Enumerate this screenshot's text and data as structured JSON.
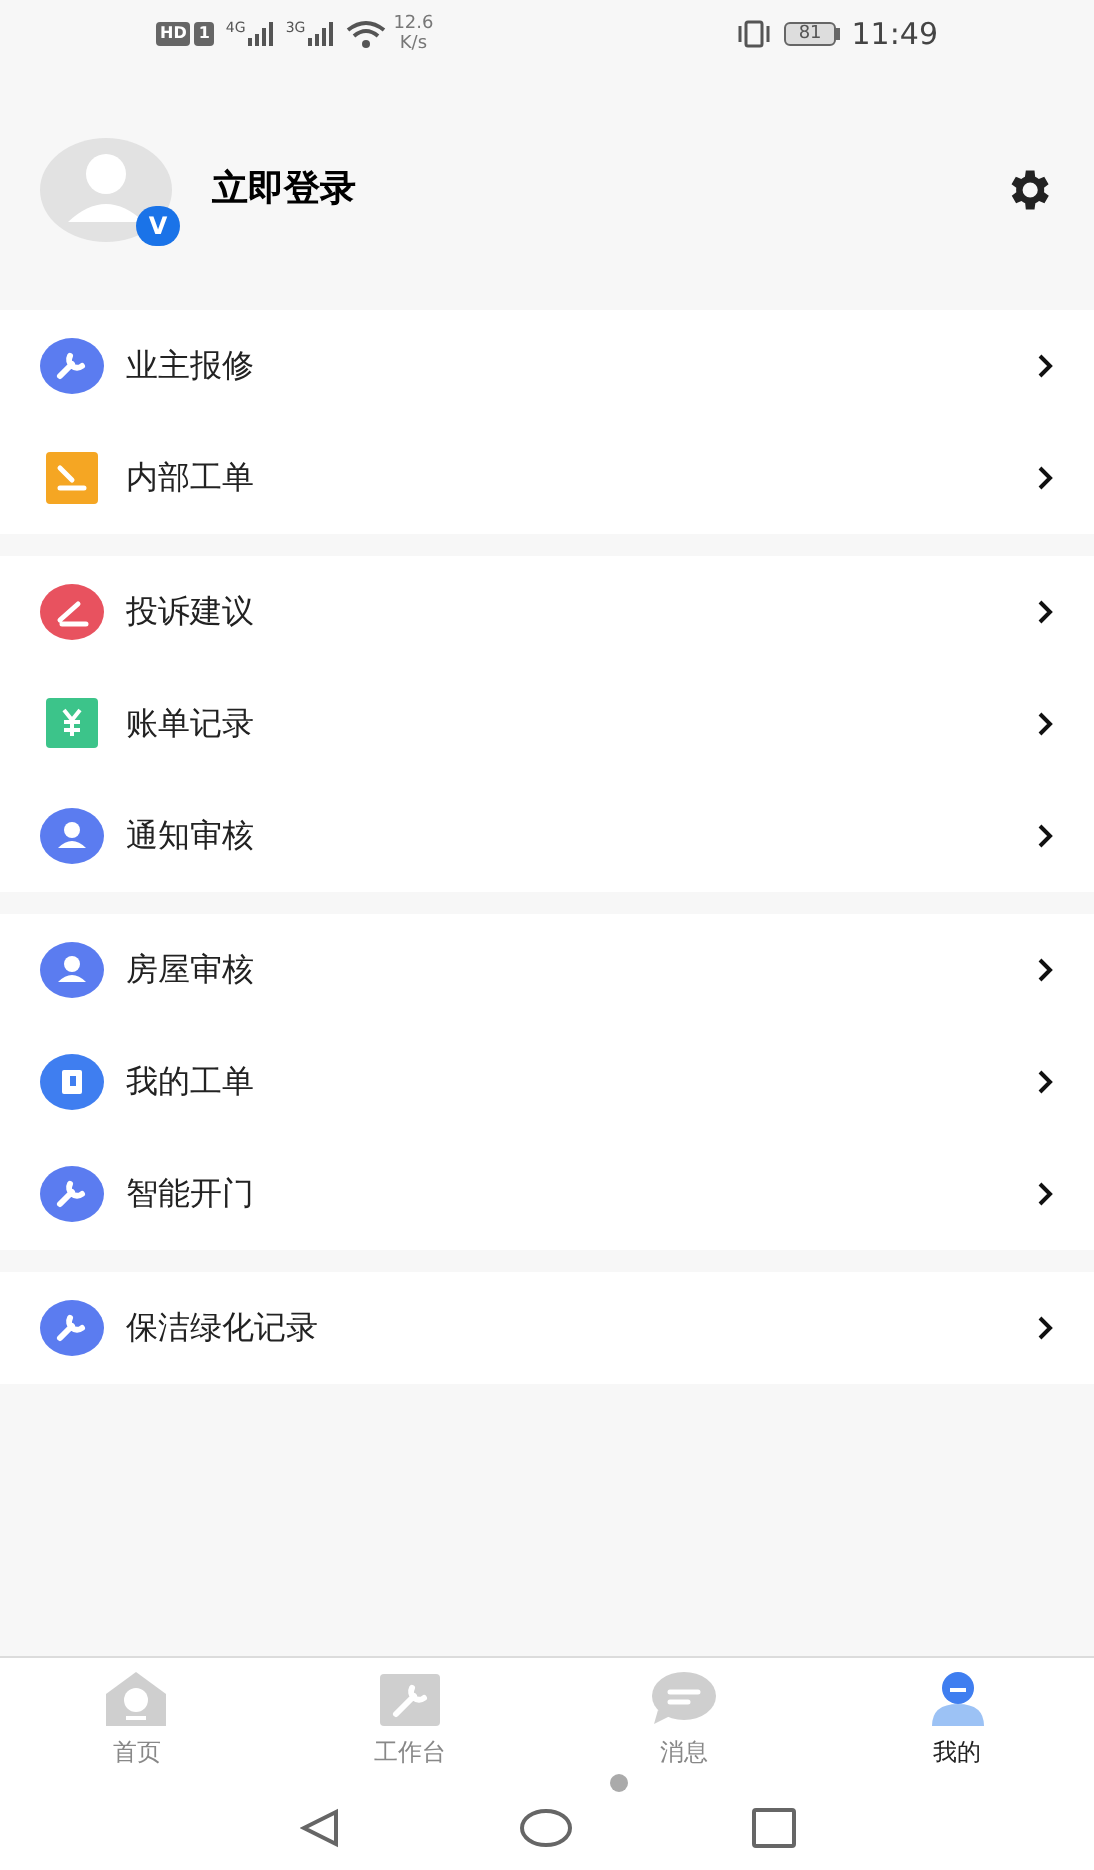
{
  "status_bar": {
    "hd": "HD",
    "sim": "1",
    "net_1": "4G",
    "net_2": "3G",
    "speed": "12.6",
    "speed_unit": "K/s",
    "battery": "81",
    "time": "11:49"
  },
  "profile": {
    "login": "立即登录",
    "badge": "V"
  },
  "menu_groups": [
    {
      "items": [
        {
          "label": "业主报修",
          "kind": "wrench"
        },
        {
          "label": "内部工单",
          "kind": "ticket"
        }
      ]
    },
    {
      "items": [
        {
          "label": "投诉建议",
          "kind": "pen"
        },
        {
          "label": "账单记录",
          "kind": "bill"
        },
        {
          "label": "通知审核",
          "kind": "person"
        }
      ]
    },
    {
      "items": [
        {
          "label": "房屋审核",
          "kind": "person"
        },
        {
          "label": "我的工单",
          "kind": "book"
        },
        {
          "label": "智能开门",
          "kind": "wrench"
        }
      ]
    },
    {
      "items": [
        {
          "label": "保洁绿化记录",
          "kind": "wrench"
        }
      ]
    }
  ],
  "tabs": [
    {
      "label": "首页",
      "kind": "home",
      "selected": false
    },
    {
      "label": "工作台",
      "kind": "tools",
      "selected": false
    },
    {
      "label": "消息",
      "kind": "chat",
      "selected": false
    },
    {
      "label": "我的",
      "kind": "user",
      "selected": true
    }
  ]
}
